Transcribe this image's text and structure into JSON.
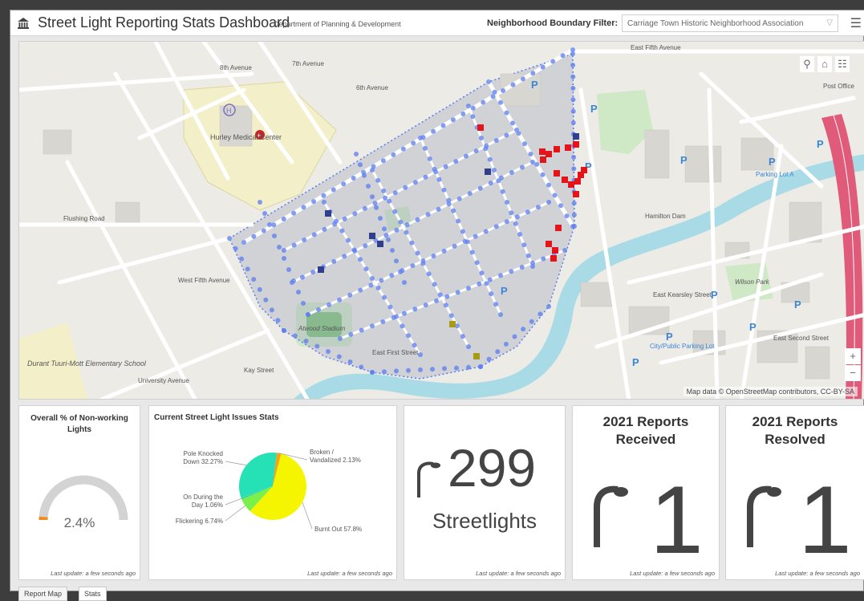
{
  "header": {
    "title": "Street Light Reporting Stats Dashboard",
    "subtitle": "Department of Planning & Development",
    "filter_label": "Neighborhood Boundary Filter:",
    "filter_value": "Carriage Town Historic Neighborhood Association"
  },
  "map": {
    "attribution": "Map data © OpenStreetMap contributors, CC-BY-SA",
    "labels": {
      "hurley": "Hurley Medical Center",
      "durant": "Durant Tuuri-Mott Elementary School",
      "atwood": "Atwood Stadium",
      "hamilton_dam": "Hamilton Dam",
      "wilson_park": "Wilson Park",
      "city_parking": "City/Public Parking Lot",
      "parking_lot_a": "Parking Lot A",
      "post_office": "Post Office",
      "east_fifth": "East Fifth Avenue",
      "flushing": "Flushing Road",
      "west_fifth": "West Fifth Avenue",
      "eighth": "8th Avenue",
      "seventh": "7th Avenue",
      "sixth": "6th Avenue",
      "university": "University Avenue",
      "kay": "Kay Street",
      "first_street": "East First Street",
      "east_kearsley": "East Kearsley Street",
      "second_street": "East Second Street"
    }
  },
  "gauge": {
    "title": "Overall % of Non-working Lights",
    "value_label": "2.4%",
    "value": 2.4,
    "last_update": "Last update: a few seconds ago"
  },
  "issues": {
    "title": "Current Street Light Issues Stats",
    "last_update": "Last update: a few seconds ago",
    "chart_data": {
      "type": "pie",
      "slices": [
        {
          "label": "Burnt Out 57.8%",
          "value": 57.8,
          "color": "#f5f500"
        },
        {
          "label": "Flickering 6.74%",
          "value": 6.74,
          "color": "#7cf04a"
        },
        {
          "label": "On During the Day 1.06%",
          "value": 1.06,
          "color": "#3fd79a"
        },
        {
          "label": "Pole Knocked Down 32.27%",
          "value": 32.27,
          "color": "#26e0b6"
        },
        {
          "label": "Broken / Vandalized 2.13%",
          "value": 2.13,
          "color": "#f2a31d"
        }
      ]
    }
  },
  "streetlights": {
    "count": "299",
    "label": "Streetlights",
    "last_update": "Last update: a few seconds ago"
  },
  "received": {
    "title_line1": "2021 Reports",
    "title_line2": "Received",
    "count": "1",
    "last_update": "Last update: a few seconds ago"
  },
  "resolved": {
    "title_line1": "2021 Reports",
    "title_line2": "Resolved",
    "count": "1",
    "last_update": "Last update: a few seconds ago"
  },
  "tabs": [
    {
      "label": "Report Map"
    },
    {
      "label": "Stats"
    }
  ],
  "colors": {
    "dot": "#5b7cf0",
    "report_red": "#e3151a",
    "report_navy": "#2f3f8c",
    "gauge_track": "#d3d3d3",
    "gauge_fill": "#f28c18"
  }
}
